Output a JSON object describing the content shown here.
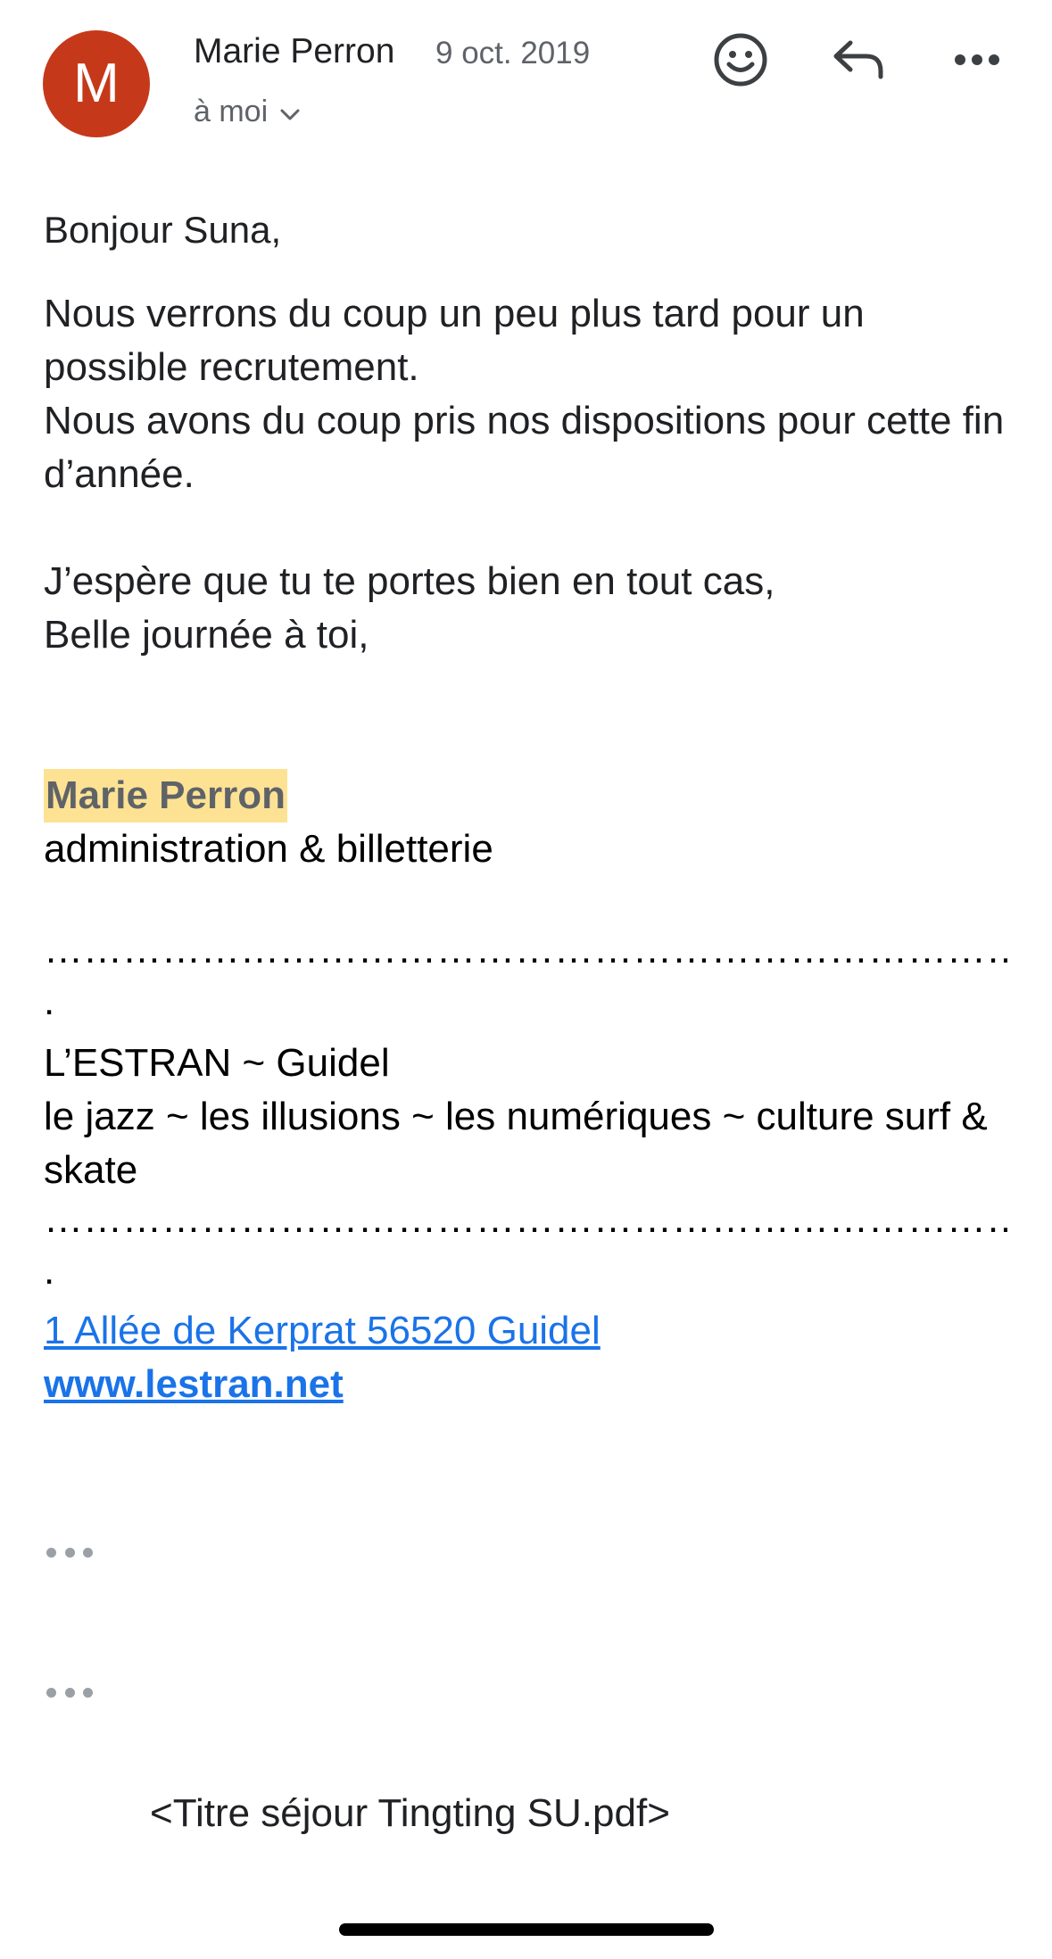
{
  "header": {
    "avatar_letter": "M",
    "sender_name": "Marie Perron",
    "date": "9 oct. 2019",
    "recipient": "à moi"
  },
  "icons": {
    "emoji": "smiley-face-icon",
    "reply": "reply-arrow-icon",
    "more": "more-horizontal-icon",
    "recipient_toggle": "chevron-down-icon"
  },
  "message": {
    "greeting": "Bonjour Suna,",
    "paragraph1": "Nous verrons du coup un peu plus tard pour un possible recrutement.\nNous avons du coup pris nos dispositions pour cette fin d’année.",
    "paragraph2": "J’espère que tu te portes bien en tout cas,\nBelle journée à toi,"
  },
  "signature": {
    "name": "Marie Perron",
    "role": "administration & billetterie",
    "separator": "……………………………………………………………………………………",
    "separator_tail": ".",
    "org_line1": "L’ESTRAN ~ Guidel",
    "org_line2": "le jazz ~ les illusions ~ les numériques ~ culture surf & skate",
    "address": "1 Allée de Kerprat 56520 Guidel",
    "website": "www.lestran.net"
  },
  "attachment": {
    "filename": "<Titre séjour Tingting SU.pdf>"
  },
  "colors": {
    "avatar": "#c5391a",
    "link": "#1a73e8",
    "highlight": "#fde293",
    "secondary_text": "#5f6368"
  }
}
